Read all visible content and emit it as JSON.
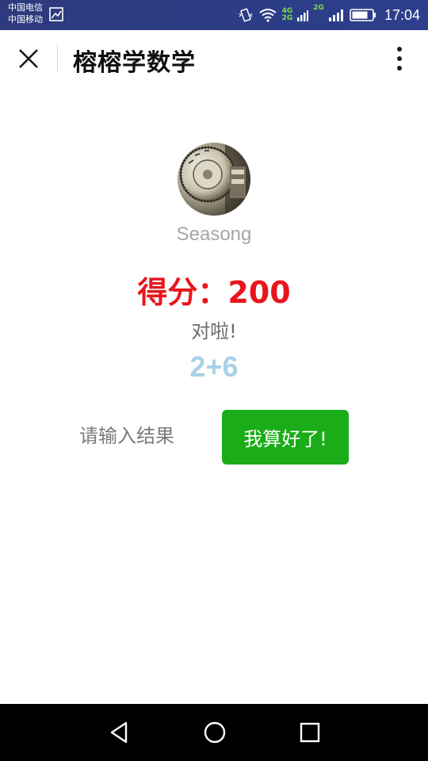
{
  "status_bar": {
    "carrier_1": "中国电信",
    "carrier_2": "中国移动",
    "network_1": "4G",
    "network_2": "2G",
    "network_3": "2G",
    "time": "17:04",
    "icons": [
      "image-icon",
      "vibrate-icon",
      "wifi-icon",
      "signal-icon",
      "battery-icon"
    ]
  },
  "header": {
    "title": "榕榕学数学",
    "close_icon": "close-icon",
    "more_icon": "more-vertical-icon"
  },
  "user": {
    "name": "Seasong"
  },
  "game": {
    "score_text": "得分：200",
    "feedback": "对啦!",
    "question": "2+6"
  },
  "answer": {
    "placeholder": "请输入结果",
    "value": ""
  },
  "submit": {
    "label": "我算好了!"
  },
  "nav_bar": {
    "icons": [
      "back-icon",
      "home-icon",
      "recents-icon"
    ]
  },
  "colors": {
    "status_bar": "#2d3b82",
    "score": "#e8161c",
    "question": "#a9d1e6",
    "button": "#1aad19"
  }
}
